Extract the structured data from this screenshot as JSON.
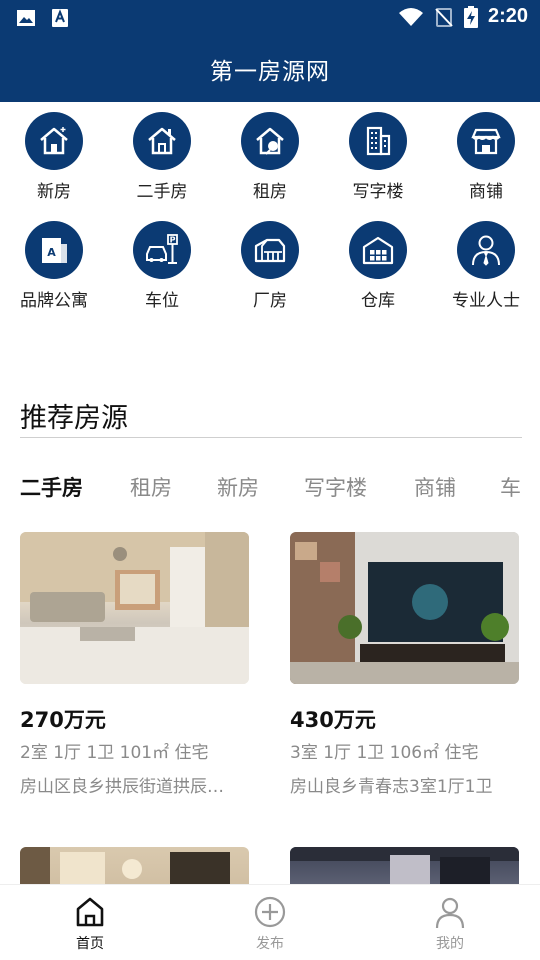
{
  "status_bar": {
    "time": "2:20",
    "icons": [
      "image-icon",
      "font-app-icon",
      "wifi-icon",
      "no-signal-icon",
      "battery-charging-icon"
    ]
  },
  "header": {
    "title": "第一房源网"
  },
  "categories": [
    {
      "label": "新房",
      "icon": "new-house-icon"
    },
    {
      "label": "二手房",
      "icon": "second-hand-house-icon"
    },
    {
      "label": "租房",
      "icon": "rent-house-icon"
    },
    {
      "label": "写字楼",
      "icon": "office-building-icon"
    },
    {
      "label": "商铺",
      "icon": "shop-icon"
    },
    {
      "label": "品牌公寓",
      "icon": "apartment-icon"
    },
    {
      "label": "车位",
      "icon": "parking-icon"
    },
    {
      "label": "厂房",
      "icon": "factory-icon"
    },
    {
      "label": "仓库",
      "icon": "warehouse-icon"
    },
    {
      "label": "专业人士",
      "icon": "professional-icon"
    }
  ],
  "recommend": {
    "title": "推荐房源",
    "tabs": [
      "二手房",
      "租房",
      "新房",
      "写字楼",
      "商铺",
      "车"
    ],
    "active_tab": 0,
    "listings": [
      {
        "price": "270万元",
        "spec": "2室 1厅 1卫 101㎡ 住宅",
        "address": "房山区良乡拱辰街道拱辰…"
      },
      {
        "price": "430万元",
        "spec": "3室 1厅 1卫 106㎡ 住宅",
        "address": "房山良乡青春志3室1厅1卫"
      },
      {
        "price": "",
        "spec": "",
        "address": ""
      },
      {
        "price": "",
        "spec": "",
        "address": ""
      }
    ]
  },
  "bottom_nav": [
    {
      "label": "首页",
      "icon": "home-icon",
      "active": true
    },
    {
      "label": "发布",
      "icon": "add-circle-icon",
      "active": false
    },
    {
      "label": "我的",
      "icon": "profile-icon",
      "active": false
    }
  ],
  "colors": {
    "brand": "#0b3a73",
    "muted_text": "#8a8a8a",
    "background": "#ffffff"
  }
}
